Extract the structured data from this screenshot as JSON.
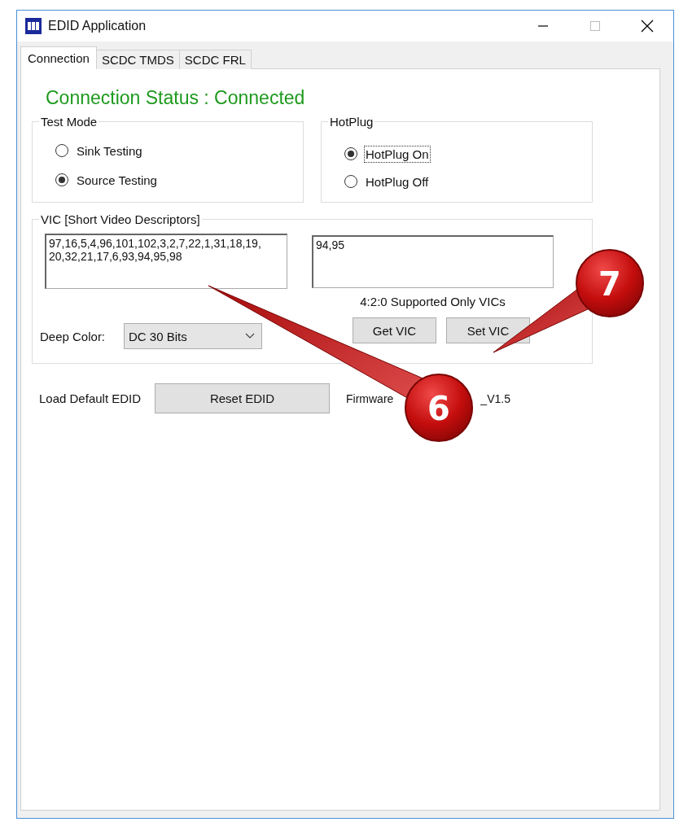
{
  "window": {
    "title": "EDID Application"
  },
  "tabs": [
    {
      "label": "Connection",
      "selected": true
    },
    {
      "label": "SCDC TMDS",
      "selected": false
    },
    {
      "label": "SCDC FRL",
      "selected": false
    }
  ],
  "connection_status": "Connection Status : Connected",
  "test_mode": {
    "title": "Test Mode",
    "options": [
      {
        "label": "Sink Testing",
        "selected": false
      },
      {
        "label": "Source Testing",
        "selected": true
      }
    ]
  },
  "hotplug": {
    "title": "HotPlug",
    "options": [
      {
        "label": "HotPlug On",
        "selected": true,
        "focused": true
      },
      {
        "label": "HotPlug Off",
        "selected": false,
        "focused": false
      }
    ]
  },
  "vic": {
    "title": "VIC [Short Video Descriptors]",
    "vic_lines": [
      "97,16,5,4,96,101,102,3,2,7,22,1,31,18,19,",
      "20,32,21,17,6,93,94,95,98"
    ],
    "yuv420_value": "94,95",
    "yuv420_caption": "4:2:0 Supported Only VICs",
    "deep_color": {
      "label": "Deep Color:",
      "value": "DC 30 Bits"
    },
    "buttons": [
      "Get VIC",
      "Set VIC"
    ]
  },
  "default_edid": {
    "label": "Load Default EDID",
    "button": "Reset EDID"
  },
  "firmware": {
    "visible_parts": [
      "Firmware",
      "_V1.5"
    ]
  },
  "callouts": [
    {
      "number": "6"
    },
    {
      "number": "7"
    }
  ]
}
